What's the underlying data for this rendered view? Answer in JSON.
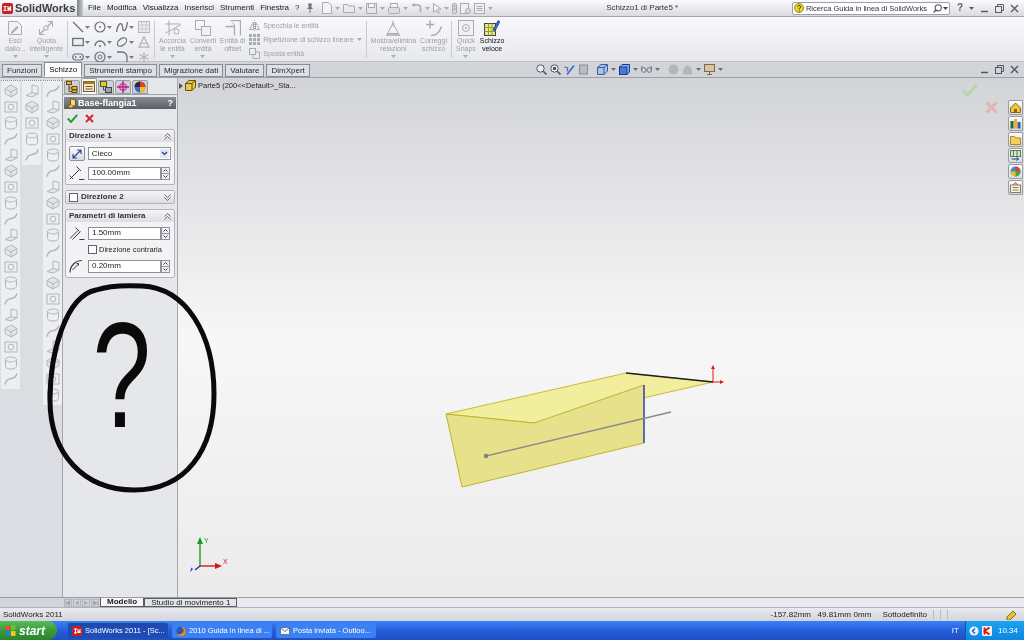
{
  "app": {
    "name": "SolidWorks"
  },
  "menu": [
    {
      "label": "File"
    },
    {
      "label": "Modifica"
    },
    {
      "label": "Visualizza"
    },
    {
      "label": "Inserisci"
    },
    {
      "label": "Strumenti"
    },
    {
      "label": "Finestra"
    },
    {
      "label": "?"
    }
  ],
  "window": {
    "title": "Schizzo1 di Parte5 *"
  },
  "search": {
    "placeholder": "Ricerca Guida in linea di SolidWorks"
  },
  "title_controls": {
    "help": "?"
  },
  "ribbon": [
    {
      "kind": "large",
      "label": "Esci\ndallo...",
      "disabled": true,
      "dropdown": true
    },
    {
      "kind": "large",
      "label": "Quota\nintelligente",
      "disabled": true,
      "dropdown": true
    },
    {
      "kind": "tools"
    },
    {
      "kind": "large",
      "label": "Accorcia\nle entità",
      "disabled": true,
      "dropdown": true
    },
    {
      "kind": "large",
      "label": "Converti\nentità",
      "disabled": true,
      "dropdown": true
    },
    {
      "kind": "large",
      "label": "Entità di\noffset",
      "disabled": true,
      "dropdown": false
    },
    {
      "kind": "list",
      "items": [
        {
          "label": "Specchia le entità",
          "disabled": true
        },
        {
          "label": "Ripetizione di schizzo lineare",
          "disabled": true
        },
        {
          "label": "Sposta entità",
          "disabled": true
        }
      ]
    },
    {
      "kind": "large",
      "label": "Mostra/elimina\nrelazioni",
      "disabled": true,
      "dropdown": true
    },
    {
      "kind": "large",
      "label": "Correggi\nschizzo",
      "disabled": true,
      "dropdown": false
    },
    {
      "kind": "large",
      "label": "Quick\nSnaps",
      "disabled": true,
      "dropdown": true
    },
    {
      "kind": "large",
      "label": "Schizzo\nveloce",
      "disabled": false,
      "dropdown": false
    }
  ],
  "tabs": [
    {
      "label": "Funzioni",
      "selected": false
    },
    {
      "label": "Schizzo",
      "selected": true
    },
    {
      "label": "Strumenti stampo",
      "selected": false
    },
    {
      "label": "Migrazione dati",
      "selected": false
    },
    {
      "label": "Valutare",
      "selected": false
    },
    {
      "label": "DimXpert",
      "selected": false
    }
  ],
  "property_manager": {
    "tabs": [
      {
        "selected": false
      },
      {
        "selected": true
      },
      {
        "selected": false
      },
      {
        "selected": false
      },
      {
        "selected": false
      }
    ],
    "title": "Base-flangia1",
    "help": "?",
    "groups": [
      {
        "kind": "section",
        "title": "Direzione 1",
        "expanded": true,
        "rows": [
          {
            "kind": "select",
            "value": "Cieco"
          },
          {
            "kind": "spin",
            "value": "100.00mm"
          }
        ]
      },
      {
        "kind": "optional",
        "title": "Direzione 2",
        "checked": false,
        "expanded": false
      },
      {
        "kind": "section",
        "title": "Parametri di lamiera",
        "expanded": true,
        "rows": [
          {
            "kind": "spin",
            "value": "1.50mm"
          },
          {
            "kind": "checkbox",
            "label": "Direzione contraria",
            "checked": false
          },
          {
            "kind": "spin",
            "value": "0.20mm"
          }
        ]
      }
    ]
  },
  "viewport": {
    "tree_flyout": {
      "label": "Parte5  (200<<Default>_Sta..."
    },
    "triad": [
      {
        "label": "Y"
      },
      {
        "label": "X"
      }
    ]
  },
  "annotation": {
    "text": "?"
  },
  "bottom_tabs": [
    {
      "label": "Modello",
      "selected": true
    },
    {
      "label": "Studio di movimento 1",
      "selected": false
    }
  ],
  "status_bar": {
    "app": "SolidWorks 2011",
    "x": "-157.82mm",
    "y": "49.81mm",
    "z": "0mm",
    "state": "Sottodefinito"
  },
  "taskbar": {
    "start": "start",
    "tasks": [
      {
        "label": "SolidWorks 2011 - [Sc...",
        "selected": true
      },
      {
        "label": "2010 Guida in linea di ...",
        "selected": false
      },
      {
        "label": "Posta inviata - Outloo...",
        "selected": false
      }
    ],
    "language": "IT",
    "clock": "10.34"
  }
}
